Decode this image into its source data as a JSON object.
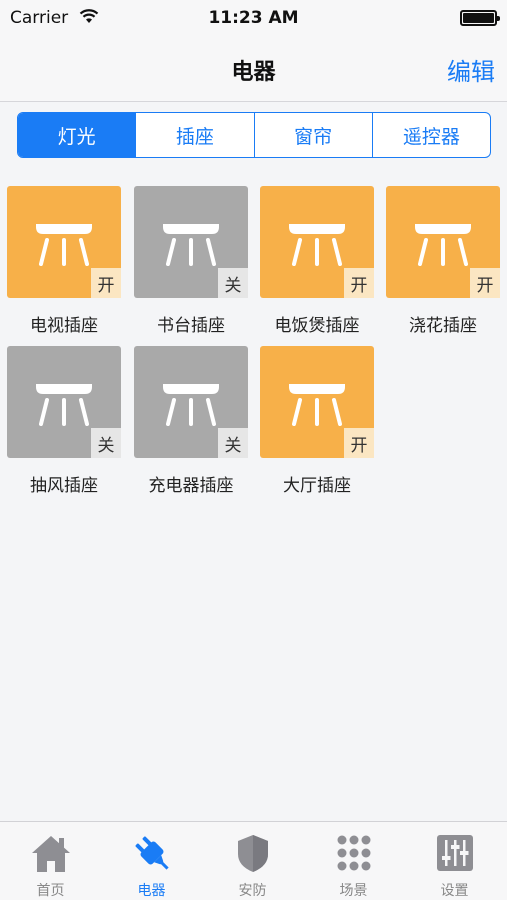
{
  "status_bar": {
    "carrier": "Carrier",
    "time": "11:23 AM"
  },
  "nav": {
    "title": "电器",
    "edit": "编辑"
  },
  "segments": [
    {
      "label": "灯光",
      "active": true
    },
    {
      "label": "插座",
      "active": false
    },
    {
      "label": "窗帘",
      "active": false
    },
    {
      "label": "遥控器",
      "active": false
    }
  ],
  "colors": {
    "accent": "#1a7cf5",
    "tile_on": "#f7b049",
    "tile_off": "#a9a9a9"
  },
  "devices": [
    {
      "name": "电视插座",
      "state": "开",
      "on": true
    },
    {
      "name": "书台插座",
      "state": "关",
      "on": false
    },
    {
      "name": "电饭煲插座",
      "state": "开",
      "on": true
    },
    {
      "name": "浇花插座",
      "state": "开",
      "on": true
    },
    {
      "name": "抽风插座",
      "state": "关",
      "on": false
    },
    {
      "name": "充电器插座",
      "state": "关",
      "on": false
    },
    {
      "name": "大厅插座",
      "state": "开",
      "on": true
    }
  ],
  "tabs": [
    {
      "label": "首页",
      "icon": "home-icon",
      "active": false
    },
    {
      "label": "电器",
      "icon": "plug-icon",
      "active": true
    },
    {
      "label": "安防",
      "icon": "shield-icon",
      "active": false
    },
    {
      "label": "场景",
      "icon": "grid-dots-icon",
      "active": false
    },
    {
      "label": "设置",
      "icon": "sliders-icon",
      "active": false
    }
  ]
}
